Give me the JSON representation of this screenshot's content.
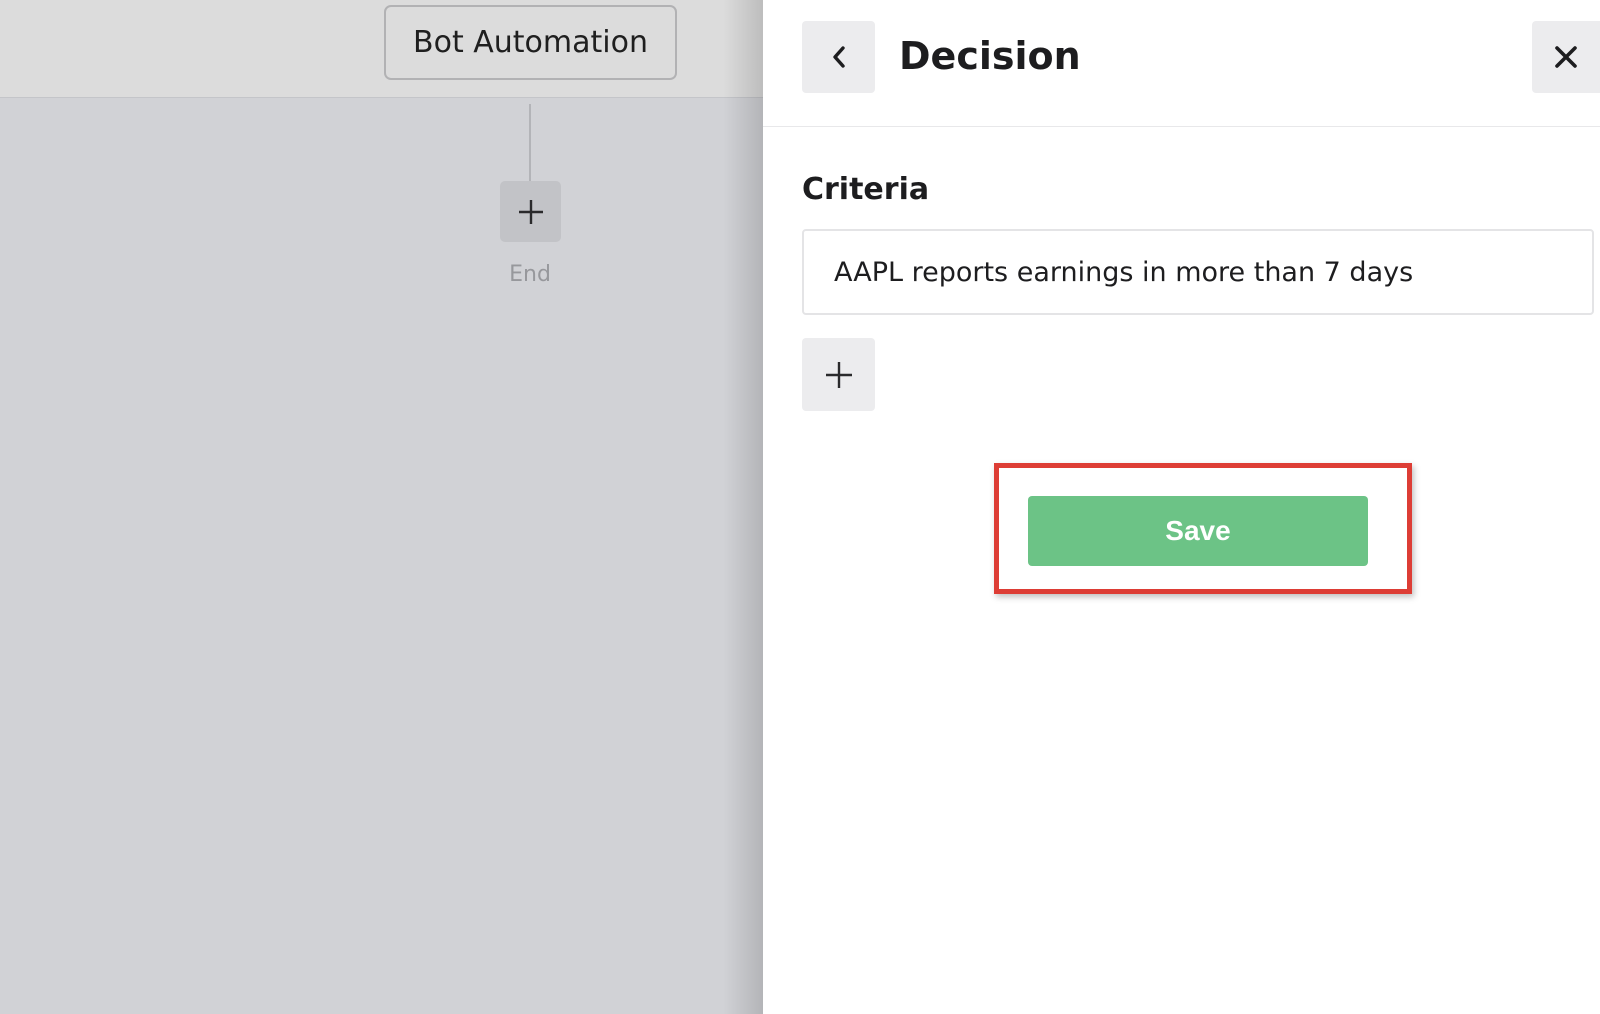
{
  "canvas": {
    "bot_node_label": "Bot Automation",
    "add_node_icon": "plus-icon",
    "end_label": "End"
  },
  "panel": {
    "back_icon": "chevron-left-icon",
    "title": "Decision",
    "close_icon": "close-icon",
    "criteria_label": "Criteria",
    "criteria_value": "AAPL reports earnings in more than 7 days",
    "add_criteria_icon": "plus-icon",
    "save_label": "Save"
  },
  "colors": {
    "save_button": "#6cc386",
    "highlight_border": "#dd3d35",
    "canvas_background": "#d1d2d6",
    "panel_background": "#ffffff"
  }
}
